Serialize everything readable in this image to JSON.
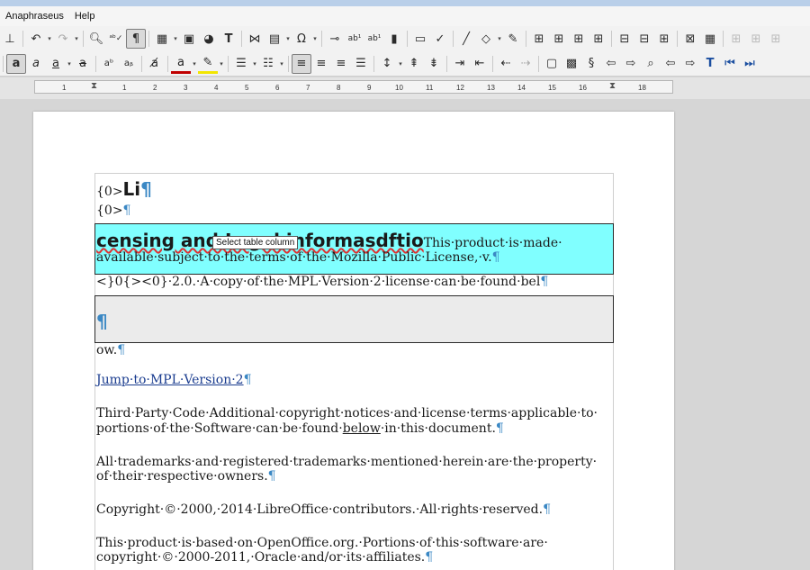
{
  "menu": {
    "app": "Anaphraseus",
    "help": "Help"
  },
  "toolbar": {
    "show_formatting_marks_icon": "pilcrow-icon",
    "bold_icon": "bold-a-icon"
  },
  "ruler": {
    "ticks": [
      "1",
      "1",
      "2",
      "3",
      "4",
      "5",
      "6",
      "7",
      "8",
      "9",
      "10",
      "11",
      "12",
      "13",
      "14",
      "15",
      "16",
      "17",
      "18"
    ]
  },
  "document": {
    "p1_prefix": "{0>",
    "p1_heading": "Li",
    "p2_text": "{0>",
    "cell1_heading": "censing and Legal informasdftio",
    "cell1_body_line1": "This·product·is·made·",
    "cell1_body_line2": "available·subject·to·the·terms·of·the·Mozilla·Public·License,·v.",
    "p3_text": "<}0{><0}·2.0.·A·copy·of·the·MPL·Version·2·license·can·be·found·bel",
    "p4_text": "ow.",
    "link_text": "Jump·to·MPL·Version·2",
    "p5_line1": "Third·Party·Code·Additional·copyright·notices·and·license·terms·applicable·to·",
    "p5_line2_a": "portions·of·the·Software·can·be·found·",
    "p5_line2_link": "below",
    "p5_line2_b": "·in·this·document.",
    "p6_line1": "All·trademarks·and·registered·trademarks·mentioned·herein·are·the·property·",
    "p6_line2": "of·their·respective·owners.",
    "p7_text": "Copyright·©·2000,·2014·LibreOffice·contributors.·All·rights·reserved.",
    "p8_line1": "This·product·is·based·on·OpenOffice.org.·Portions·of·this·software·are·",
    "p8_line2": "copyright·©·2000-2011,·Oracle·and/or·its·affiliates.",
    "pilcrow": "¶"
  },
  "tooltip": {
    "text": "Select table column"
  }
}
